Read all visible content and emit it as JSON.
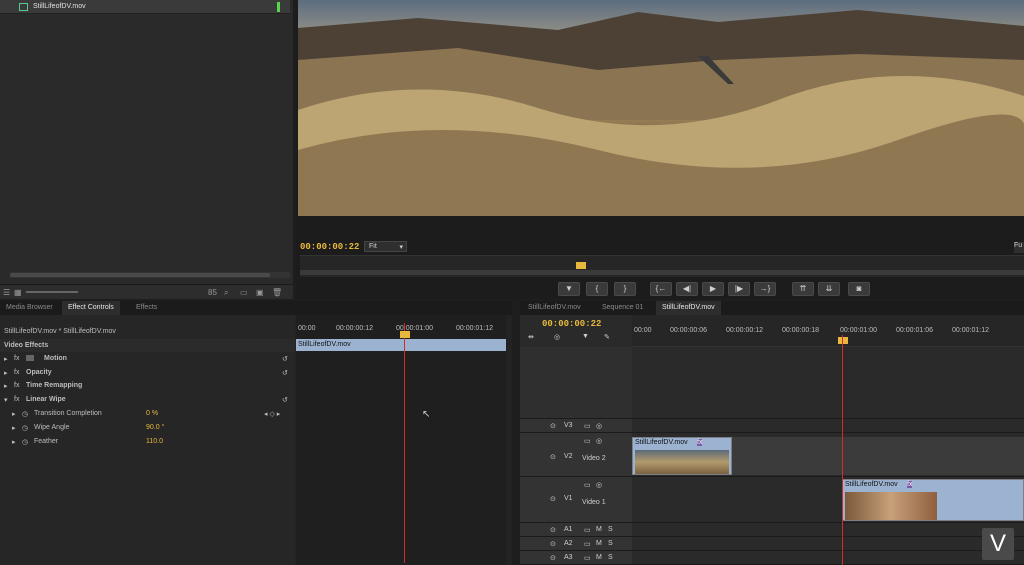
{
  "project_panel": {
    "clip_name": "StillLifeofDV.mov",
    "bottom_label": "85",
    "icons": [
      "list-view-icon",
      "icon-view-icon",
      "zoom-slider",
      "search-icon",
      "folder-icon",
      "new-item-icon",
      "trash-icon"
    ]
  },
  "program_monitor": {
    "timecode": "00:00:00:22",
    "fit": "Fit",
    "right_edge_label": "Fu",
    "transport": [
      {
        "name": "add-marker-button",
        "glyph": "▼"
      },
      {
        "name": "mark-in-button",
        "glyph": "{"
      },
      {
        "name": "mark-out-button",
        "glyph": "}"
      },
      {
        "name": "go-to-in-button",
        "glyph": "{←"
      },
      {
        "name": "step-back-button",
        "glyph": "◀|"
      },
      {
        "name": "play-button",
        "glyph": "▶"
      },
      {
        "name": "step-forward-button",
        "glyph": "|▶"
      },
      {
        "name": "go-to-out-button",
        "glyph": "→}"
      },
      {
        "name": "lift-button",
        "glyph": "⇈"
      },
      {
        "name": "extract-button",
        "glyph": "⇊"
      },
      {
        "name": "export-frame-button",
        "glyph": "◙"
      }
    ]
  },
  "effect_controls": {
    "tabs": [
      "Media Browser",
      "Effect Controls",
      "Effects"
    ],
    "source_title": "StillLifeofDV.mov * StillLifeofDV.mov",
    "section": "Video Effects",
    "rows": [
      {
        "label": "Motion",
        "fx": "fx"
      },
      {
        "label": "Opacity",
        "fx": "fx"
      },
      {
        "label": "Time Remapping",
        "fx": "fx"
      },
      {
        "label": "Linear Wipe",
        "fx": "fx"
      }
    ],
    "params": [
      {
        "label": "Transition Completion",
        "value": "0 %"
      },
      {
        "label": "Wipe Angle",
        "value": "90.0 °"
      },
      {
        "label": "Feather",
        "value": "110.0"
      }
    ],
    "mini_ruler": [
      "00:00",
      "00:00:00:12",
      "00:00:01:00",
      "00:00:01:12"
    ],
    "mini_clip": "StillLifeofDV.mov"
  },
  "timeline": {
    "tabs": [
      "StillLifeofDV.mov",
      "Sequence 01",
      "StillLifeofDV.mov"
    ],
    "timecode": "00:00:00:22",
    "ruler": [
      "00:00",
      "00:00:00:06",
      "00:00:00:12",
      "00:00:00:18",
      "00:00:01:00",
      "00:00:01:06",
      "00:00:01:12"
    ],
    "tracks": {
      "v3": "V3",
      "v2": "V2",
      "v2_name": "Video 2",
      "v1": "V1",
      "v1_name": "Video 1",
      "a1": "A1",
      "a2": "A2",
      "a3": "A3"
    },
    "v2_clip": "StillLifeofDV.mov",
    "v1_clip": "StillLifeofDV.mov",
    "v2_fx": "fx",
    "v1_fx": "fx",
    "m": "M",
    "s": "S"
  },
  "watermark": "V",
  "colors": {
    "accent": "#e7b83c",
    "playhead": "#d62b2b"
  }
}
